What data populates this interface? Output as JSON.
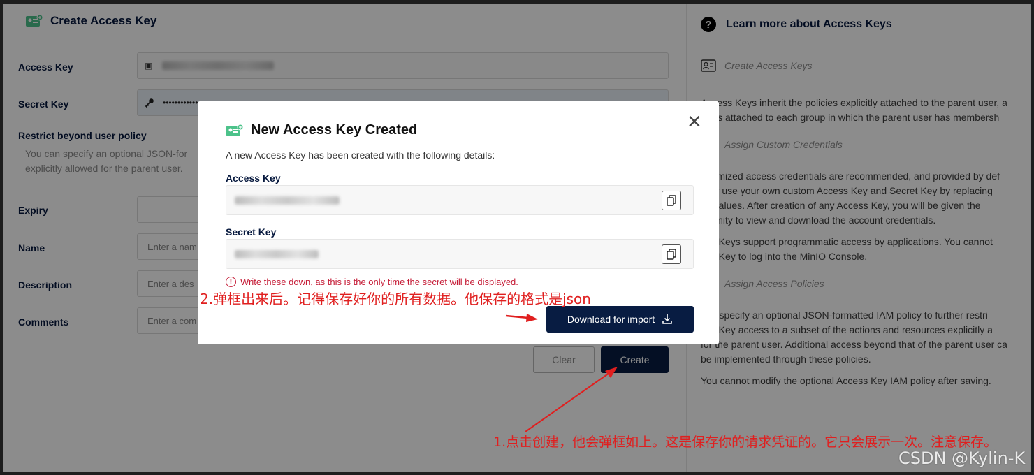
{
  "page": {
    "title": "Create Access Key",
    "fields": {
      "access_key_label": "Access Key",
      "secret_key_label": "Secret Key",
      "secret_key_value": "••••••••••••",
      "restrict_title": "Restrict beyond user policy",
      "restrict_text_1": "You can specify an optional JSON-for",
      "restrict_text_2": "explicitly allowed for the parent user.",
      "expiry_label": "Expiry",
      "name_label": "Name",
      "name_placeholder": "Enter a nam",
      "description_label": "Description",
      "description_placeholder": "Enter a des",
      "comments_label": "Comments",
      "comments_placeholder": "Enter a com"
    },
    "buttons": {
      "clear": "Clear",
      "create": "Create"
    }
  },
  "sidebar": {
    "title": "Learn more about Access Keys",
    "sections": [
      {
        "heading": "Create Access Keys",
        "text": []
      },
      {
        "heading": "",
        "text": [
          "Access Keys inherit the policies explicitly attached to the parent user, a",
          "licies attached to each group in which the parent user has membersh"
        ]
      },
      {
        "heading": "Assign Custom Credentials",
        "text": []
      },
      {
        "heading": "",
        "text": [
          "ndomized access credentials are recommended, and provided by def",
          "may use your own custom Access Key and Secret Key by replacing",
          "ult values. After creation of any Access Key, you will be given the",
          "ortunity to view and download the account credentials."
        ]
      },
      {
        "heading": "",
        "text": [
          "ess Keys support programmatic access by applications. You cannot",
          "ess Key to log into the MinIO Console."
        ]
      },
      {
        "heading": "Assign Access Policies",
        "text": []
      },
      {
        "heading": "",
        "text": [
          "can specify an optional JSON-formatted IAM policy to further restri",
          "ess Key access to a subset of the actions and resources explicitly a",
          "for the parent user. Additional access beyond that of the parent user ca",
          "be implemented through these policies."
        ]
      },
      {
        "heading": "",
        "text": [
          "You cannot modify the optional Access Key IAM policy after saving."
        ]
      }
    ]
  },
  "modal": {
    "title": "New Access Key Created",
    "description": "A new Access Key has been created with the following details:",
    "access_key_label": "Access Key",
    "secret_key_label": "Secret Key",
    "warning": "Write these down, as this is the only time the secret will be displayed.",
    "download_button": "Download for import",
    "close_symbol": "✕"
  },
  "annotations": {
    "step2": "2.弹框出来后。记得保存好你的所有数据。他保存的格式是json",
    "step1": "1.点击创建，他会弹框如上。这是保存你的请求凭证的。它只会展示一次。注意保存。"
  },
  "watermark": "CSDN @Kylin-K",
  "colors": {
    "primary": "#081c42",
    "warning": "#c51b36",
    "annotation": "#e01f1f",
    "accent_green": "#4cc28a"
  }
}
